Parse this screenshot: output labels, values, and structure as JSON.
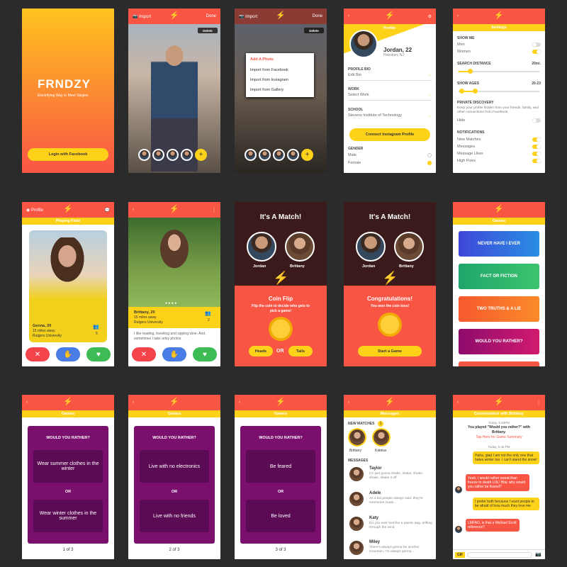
{
  "s1": {
    "logo": "FRNDZY",
    "tagline": "Electrifying Way to Meet Singles",
    "login": "Login with Facebook"
  },
  "s2": {
    "import": "Import",
    "done": "Done",
    "delete": "Delete"
  },
  "s3": {
    "import": "Import",
    "done": "Done",
    "delete": "Delete",
    "menu": [
      "Add A Photo",
      "Import from Facebook",
      "Import from Instagram",
      "Import from Gallery"
    ]
  },
  "s4": {
    "title": "Profile",
    "name": "Jordan, 22",
    "location": "Hoboken, NJ",
    "bio_label": "PROFILE BIO",
    "bio_placeholder": "Edit Bio",
    "work_label": "WORK",
    "work_placeholder": "Select Work",
    "school_label": "SCHOOL",
    "school": "Stevens Institute of Technology",
    "connect": "Connect Instagram Profile",
    "gender_label": "GENDER",
    "male": "Male",
    "female": "Female"
  },
  "s5": {
    "title": "Settings",
    "show_me": "SHOW ME",
    "men": "Men",
    "women": "Women",
    "distance_label": "SEARCH DISTANCE",
    "distance": "20mi.",
    "ages_label": "SHOW AGES",
    "ages": "20-23",
    "private_label": "PRIVATE DISCOVERY",
    "private_text": "Keep your profile hidden from your friends, family, and other connections from Facebook.",
    "hide": "Hide",
    "notif_label": "NOTIFICATIONS",
    "notifs": [
      "New Matches",
      "Messages",
      "Message Likes",
      "High Fives"
    ]
  },
  "s6": {
    "profile": "Profile",
    "title": "Playing Field",
    "name": "Genna, 20",
    "dist": "15 miles away",
    "school": "Rutgers University",
    "count": "5"
  },
  "s7": {
    "name": "Brittany, 20",
    "dist": "15 miles away",
    "school": "Rutgers University",
    "count": "2",
    "bio": "I like reading, traveling and sipping wine. And, sometimes I take artsy photos"
  },
  "s8": {
    "title": "It's A Match!",
    "left": "Jordan",
    "right": "Brittany",
    "coin": "Coin Flip",
    "desc": "Flip the coin to decide who gets to pick a game!",
    "heads": "Heads",
    "or": "OR",
    "tails": "Tails"
  },
  "s9": {
    "title": "It's A Match!",
    "left": "Jordan",
    "right": "Brittany",
    "congrats": "Congratulations!",
    "won": "You won the coin toss!",
    "start": "Start a Game"
  },
  "s10": {
    "title": "Games",
    "games": [
      "NEVER HAVE I EVER",
      "FACT OR FICTION",
      "TWO TRUTHS & A LIE",
      "WOULD YOU RATHER?"
    ],
    "colors": [
      "#3e47d8",
      "#1fa56b",
      "#f75a2e",
      "#8e0c6d"
    ]
  },
  "w1": {
    "title": "Games",
    "q": "WOULD YOU RATHER?",
    "a": "Wear summer clothes in the winter",
    "or": "OR",
    "b": "Wear winter clothes in the summer",
    "page": "1 of 3"
  },
  "w2": {
    "title": "Games",
    "q": "WOULD YOU RATHER?",
    "a": "Live with no electronics",
    "or": "OR",
    "b": "Live with no friends",
    "page": "2 of 3"
  },
  "w3": {
    "title": "Games",
    "q": "WOULD YOU RATHER?",
    "a": "Be feared",
    "or": "OR",
    "b": "Be loved",
    "page": "3 of 3"
  },
  "m": {
    "title": "Messages",
    "new": "NEW MATCHES",
    "count": "1",
    "matches": [
      "Brittany",
      "Katniss"
    ],
    "msgs_label": "MESSAGES",
    "msgs": [
      {
        "name": "Taylor",
        "text": "I'm just gonna shake, shake, shake, shake, shake it off."
      },
      {
        "name": "Adele",
        "text": "As a kid people always said, they're memories made..."
      },
      {
        "name": "Katy",
        "text": "Do you ever feel like a plastic bag, drifting through the wind."
      },
      {
        "name": "Miley",
        "text": "There's always gonna be another mountain. I'm always gonna..."
      }
    ]
  },
  "c": {
    "title": "Conversation with Brittany",
    "t1": "Today, 5:34PM",
    "sys": "You played \"Would you rather?\" with Brittany.",
    "link": "Tap Here for Game Summary",
    "t2": "Today, 5:46 PM",
    "b1": "Haha, glad I am not the only one that hates winter too. I can't stand the snow!",
    "b2": "Yeah, I would rather sweat than freeze to death LOL! Btw, why would you rather be feared?",
    "b3": "I prefer both because I want people to be afraid of how much they love me",
    "b4": "LMFAO, is that a Michael Scott reference?",
    "gif": "GIF"
  }
}
